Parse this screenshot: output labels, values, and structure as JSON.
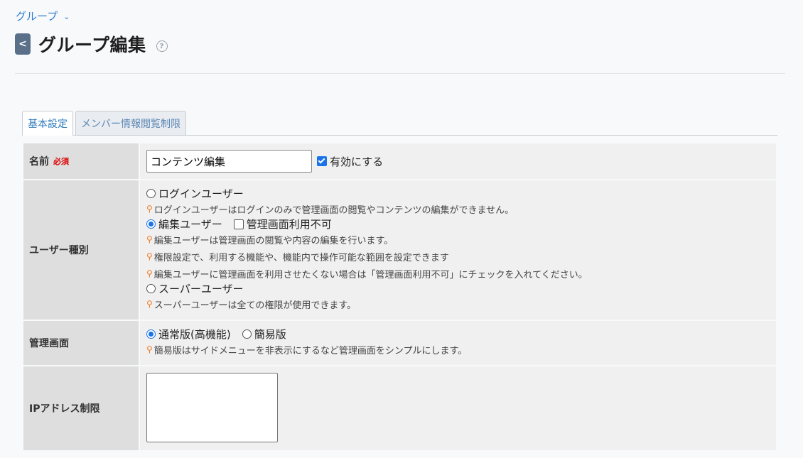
{
  "breadcrumb": {
    "label": "グループ",
    "chevron_icon": "chevron-down"
  },
  "header": {
    "back_icon": "<",
    "title": "グループ編集",
    "help_icon": "?"
  },
  "tabs": [
    {
      "label": "基本設定",
      "active": true
    },
    {
      "label": "メンバー情報閲覧制限",
      "active": false
    }
  ],
  "form": {
    "name": {
      "label": "名前",
      "required": "必須",
      "value": "コンテンツ編集",
      "enable_label": "有効にする",
      "enable_checked": true
    },
    "user_type": {
      "label": "ユーザー種別",
      "login_user": "ログインユーザー",
      "login_hint": "ログインユーザーはログインのみで管理画面の閲覧やコンテンツの編集ができません。",
      "edit_user": "編集ユーザー",
      "no_admin": "管理画面利用不可",
      "edit_hint1": "編集ユーザーは管理画面の閲覧や内容の編集を行います。",
      "edit_hint2": "権限設定で、利用する機能や、機能内で操作可能な範囲を設定できます",
      "edit_hint3": "編集ユーザーに管理画面を利用させたくない場合は「管理画面利用不可」にチェックを入れてください。",
      "super_user": "スーパーユーザー",
      "super_hint": "スーパーユーザーは全ての権限が使用できます。",
      "selected": "編集ユーザー"
    },
    "admin_screen": {
      "label": "管理画面",
      "normal": "通常版(高機能)",
      "simple": "簡易版",
      "hint": "簡易版はサイドメニューを非表示にするなど管理画面をシンプルにします。",
      "selected": "通常版(高機能)"
    },
    "ip": {
      "label": "IPアドレス制限",
      "value": ""
    }
  },
  "colors": {
    "accent": "#1a73e8",
    "link": "#2f7fd0",
    "hint_icon": "#f27c22",
    "required": "#dd0000"
  }
}
